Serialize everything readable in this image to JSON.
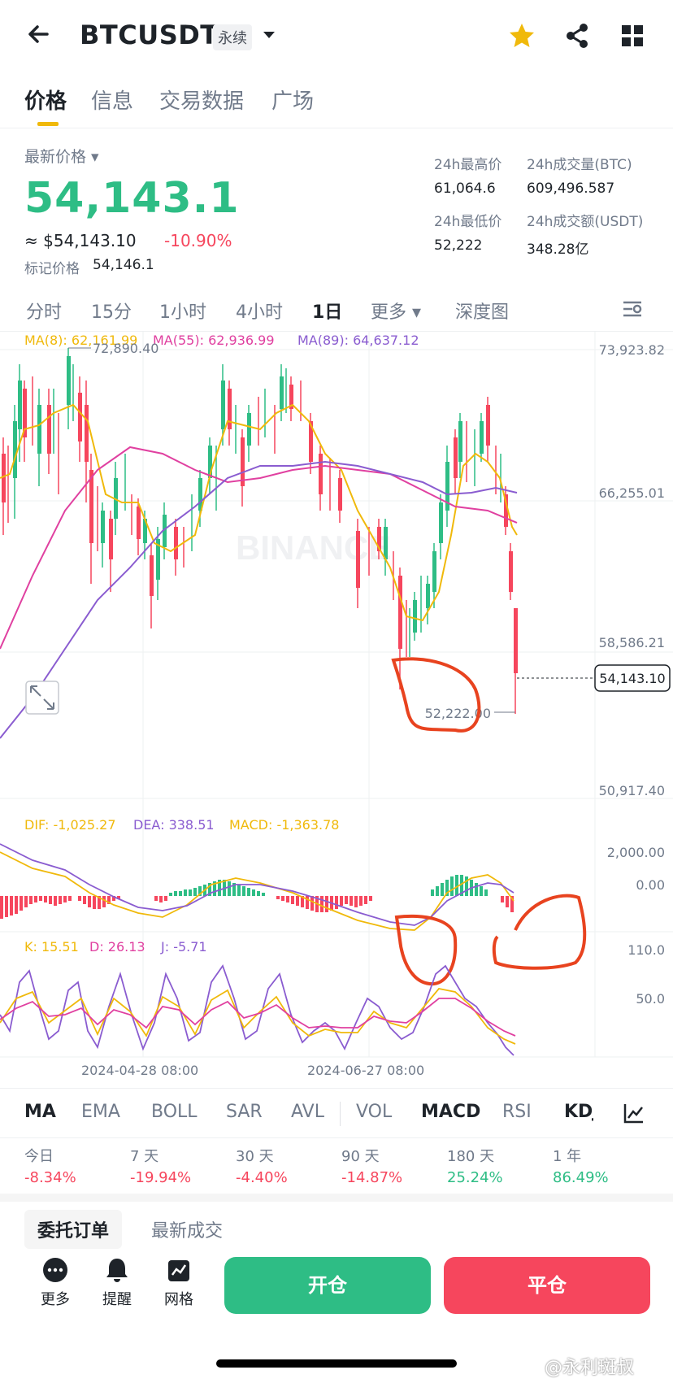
{
  "header": {
    "pair": "BTCUSDT",
    "contract_tag": "永续"
  },
  "tabs": [
    "价格",
    "信息",
    "交易数据",
    "广场"
  ],
  "price": {
    "latest_label": "最新价格",
    "last": "54,143.1",
    "approx": "≈ $54,143.10",
    "change_pct": "-10.90%",
    "mark_label": "标记价格",
    "mark_value": "54,146.1"
  },
  "stats": {
    "high_label": "24h最高价",
    "high_value": "61,064.6",
    "vol_btc_label": "24h成交量(BTC)",
    "vol_btc_value": "609,496.587",
    "low_label": "24h最低价",
    "low_value": "52,222",
    "vol_usdt_label": "24h成交额(USDT)",
    "vol_usdt_value": "348.28亿"
  },
  "intervals": [
    "分时",
    "15分",
    "1小时",
    "4小时",
    "1日",
    "更多",
    "深度图"
  ],
  "chart": {
    "ma_legend": [
      "MA(8): 62,161.99",
      "MA(55): 62,936.99",
      "MA(89): 64,637.12"
    ],
    "y_ticks": [
      "73,923.82",
      "66,255.01",
      "58,586.21",
      "50,917.40"
    ],
    "high_marker": "72,890.40",
    "low_marker": "52,222.00",
    "last_price_tag": "54,143.10",
    "macd_legend": [
      "DIF: -1,025.27",
      "DEA: 338.51",
      "MACD: -1,363.78"
    ],
    "macd_ticks": [
      "2,000.00",
      "0.00"
    ],
    "kdj_legend": [
      "K: 15.51",
      "D: 26.13",
      "J: -5.71"
    ],
    "kdj_ticks": [
      "110.0",
      "50.0"
    ],
    "dates": [
      "2024-04-28 08:00",
      "2024-06-27 08:00"
    ],
    "watermark": "BINANCE",
    "colors": {
      "up": "#2ebd85",
      "down": "#f6465d",
      "ma8": "#f0b90b",
      "ma55": "#e040a0",
      "ma89": "#8a5cd0",
      "annotation": "#e8431f"
    }
  },
  "chart_data": {
    "type": "candlestick",
    "timeframe": "1日",
    "price_range": [
      50917.4,
      73923.82
    ],
    "high": 72890.4,
    "low": 52222.0,
    "last": 54143.1,
    "ma": {
      "MA(8)": 62161.99,
      "MA(55)": 62936.99,
      "MA(89)": 64637.12
    },
    "macd": {
      "DIF": -1025.27,
      "DEA": 338.51,
      "MACD": -1363.78
    },
    "kdj": {
      "K": 15.51,
      "D": 26.13,
      "J": -5.71
    },
    "x_labels": [
      "2024-04-28 08:00",
      "2024-06-27 08:00"
    ]
  },
  "indicator_tabs": [
    "MA",
    "EMA",
    "BOLL",
    "SAR",
    "AVL",
    "VOL",
    "MACD",
    "RSI",
    "KDJ"
  ],
  "performance": [
    {
      "label": "今日",
      "value": "-8.34%",
      "sign": "neg"
    },
    {
      "label": "7 天",
      "value": "-19.94%",
      "sign": "neg"
    },
    {
      "label": "30 天",
      "value": "-4.40%",
      "sign": "neg"
    },
    {
      "label": "90 天",
      "value": "-14.87%",
      "sign": "neg"
    },
    {
      "label": "180 天",
      "value": "25.24%",
      "sign": "pos"
    },
    {
      "label": "1 年",
      "value": "86.49%",
      "sign": "pos"
    }
  ],
  "orders_tabs": [
    "委托订单",
    "最新成交"
  ],
  "bottom": {
    "more": "更多",
    "alert": "提醒",
    "grid": "网格",
    "open": "开仓",
    "close": "平仓"
  },
  "watermark_text": "@永利斑叔"
}
